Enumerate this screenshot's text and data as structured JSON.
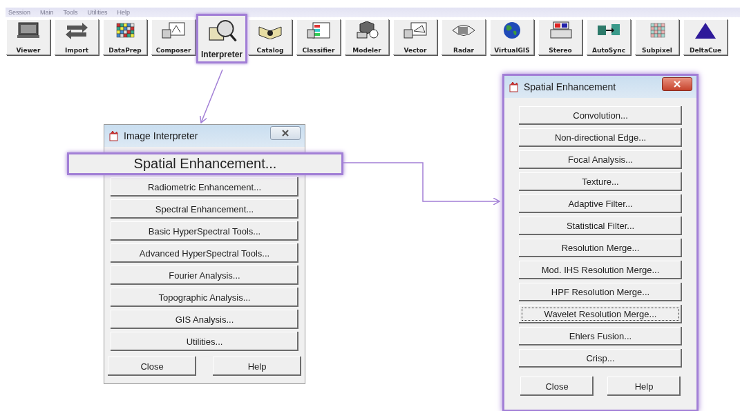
{
  "menu": [
    "Session",
    "Main",
    "Tools",
    "Utilities",
    "Help"
  ],
  "toolbar": [
    {
      "label": "Viewer",
      "highlighted": false
    },
    {
      "label": "Import",
      "highlighted": false
    },
    {
      "label": "DataPrep",
      "highlighted": false
    },
    {
      "label": "Composer",
      "highlighted": false
    },
    {
      "label": "Interpreter",
      "highlighted": true
    },
    {
      "label": "Catalog",
      "highlighted": false
    },
    {
      "label": "Classifier",
      "highlighted": false
    },
    {
      "label": "Modeler",
      "highlighted": false
    },
    {
      "label": "Vector",
      "highlighted": false
    },
    {
      "label": "Radar",
      "highlighted": false
    },
    {
      "label": "VirtualGIS",
      "highlighted": false
    },
    {
      "label": "Stereo",
      "highlighted": false
    },
    {
      "label": "AutoSync",
      "highlighted": false
    },
    {
      "label": "Subpixel",
      "highlighted": false
    },
    {
      "label": "DeltaCue",
      "highlighted": false
    }
  ],
  "image_interpreter": {
    "title": "Image Interpreter",
    "active": false,
    "items": [
      {
        "label": "Spatial Enhancement...",
        "highlighted": true
      },
      {
        "label": "Radiometric Enhancement...",
        "highlighted": false
      },
      {
        "label": "Spectral Enhancement...",
        "highlighted": false
      },
      {
        "label": "Basic HyperSpectral Tools...",
        "highlighted": false
      },
      {
        "label": "Advanced HyperSpectral Tools...",
        "highlighted": false
      },
      {
        "label": "Fourier Analysis...",
        "highlighted": false
      },
      {
        "label": "Topographic Analysis...",
        "highlighted": false
      },
      {
        "label": "GIS Analysis...",
        "highlighted": false
      },
      {
        "label": "Utilities...",
        "highlighted": false
      }
    ],
    "buttons": [
      "Close",
      "Help"
    ]
  },
  "spatial_enhancement": {
    "title": "Spatial Enhancement",
    "active": true,
    "items": [
      {
        "label": "Convolution...",
        "focused": false
      },
      {
        "label": "Non-directional Edge...",
        "focused": false
      },
      {
        "label": "Focal Analysis...",
        "focused": false
      },
      {
        "label": "Texture...",
        "focused": false
      },
      {
        "label": "Adaptive Filter...",
        "focused": false
      },
      {
        "label": "Statistical Filter...",
        "focused": false
      },
      {
        "label": "Resolution Merge...",
        "focused": false
      },
      {
        "label": "Mod. IHS Resolution Merge...",
        "focused": false
      },
      {
        "label": "HPF Resolution Merge...",
        "focused": false
      },
      {
        "label": "Wavelet Resolution Merge...",
        "focused": true
      },
      {
        "label": "Ehlers Fusion...",
        "focused": false
      },
      {
        "label": "Crisp...",
        "focused": false
      }
    ],
    "buttons": [
      "Close",
      "Help"
    ]
  }
}
